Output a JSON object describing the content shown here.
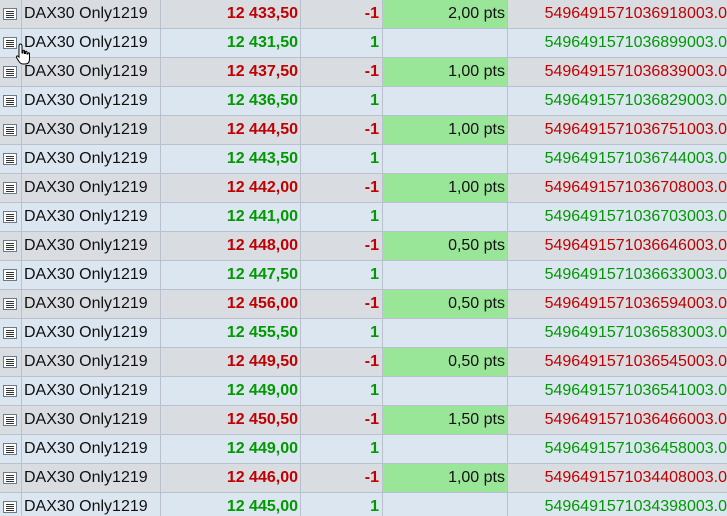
{
  "colors": {
    "sell": "#c00000",
    "buy": "#009900",
    "pts_fill": "#99e699"
  },
  "row_icon": "document-icon",
  "cursor_icon": "hand-pointer-icon",
  "rows": [
    {
      "name": "DAX30 Only1219",
      "price": "12 433,50",
      "qty": "-1",
      "pts": "2,00 pts",
      "id": "5496491571036918003.0",
      "side": "sell"
    },
    {
      "name": "DAX30 Only1219",
      "price": "12 431,50",
      "qty": "1",
      "pts": "",
      "id": "5496491571036899003.0",
      "side": "buy"
    },
    {
      "name": "DAX30 Only1219",
      "price": "12 437,50",
      "qty": "-1",
      "pts": "1,00 pts",
      "id": "5496491571036839003.0",
      "side": "sell"
    },
    {
      "name": "DAX30 Only1219",
      "price": "12 436,50",
      "qty": "1",
      "pts": "",
      "id": "5496491571036829003.0",
      "side": "buy"
    },
    {
      "name": "DAX30 Only1219",
      "price": "12 444,50",
      "qty": "-1",
      "pts": "1,00 pts",
      "id": "5496491571036751003.0",
      "side": "sell"
    },
    {
      "name": "DAX30 Only1219",
      "price": "12 443,50",
      "qty": "1",
      "pts": "",
      "id": "5496491571036744003.0",
      "side": "buy"
    },
    {
      "name": "DAX30 Only1219",
      "price": "12 442,00",
      "qty": "-1",
      "pts": "1,00 pts",
      "id": "5496491571036708003.0",
      "side": "sell"
    },
    {
      "name": "DAX30 Only1219",
      "price": "12 441,00",
      "qty": "1",
      "pts": "",
      "id": "5496491571036703003.0",
      "side": "buy"
    },
    {
      "name": "DAX30 Only1219",
      "price": "12 448,00",
      "qty": "-1",
      "pts": "0,50 pts",
      "id": "5496491571036646003.0",
      "side": "sell"
    },
    {
      "name": "DAX30 Only1219",
      "price": "12 447,50",
      "qty": "1",
      "pts": "",
      "id": "5496491571036633003.0",
      "side": "buy"
    },
    {
      "name": "DAX30 Only1219",
      "price": "12 456,00",
      "qty": "-1",
      "pts": "0,50 pts",
      "id": "5496491571036594003.0",
      "side": "sell"
    },
    {
      "name": "DAX30 Only1219",
      "price": "12 455,50",
      "qty": "1",
      "pts": "",
      "id": "5496491571036583003.0",
      "side": "buy"
    },
    {
      "name": "DAX30 Only1219",
      "price": "12 449,50",
      "qty": "-1",
      "pts": "0,50 pts",
      "id": "5496491571036545003.0",
      "side": "sell"
    },
    {
      "name": "DAX30 Only1219",
      "price": "12 449,00",
      "qty": "1",
      "pts": "",
      "id": "5496491571036541003.0",
      "side": "buy"
    },
    {
      "name": "DAX30 Only1219",
      "price": "12 450,50",
      "qty": "-1",
      "pts": "1,50 pts",
      "id": "5496491571036466003.0",
      "side": "sell"
    },
    {
      "name": "DAX30 Only1219",
      "price": "12 449,00",
      "qty": "1",
      "pts": "",
      "id": "5496491571036458003.0",
      "side": "buy"
    },
    {
      "name": "DAX30 Only1219",
      "price": "12 446,00",
      "qty": "-1",
      "pts": "1,00 pts",
      "id": "5496491571034408003.0",
      "side": "sell"
    },
    {
      "name": "DAX30 Only1219",
      "price": "12 445,00",
      "qty": "1",
      "pts": "",
      "id": "5496491571034398003.0",
      "side": "buy"
    }
  ]
}
